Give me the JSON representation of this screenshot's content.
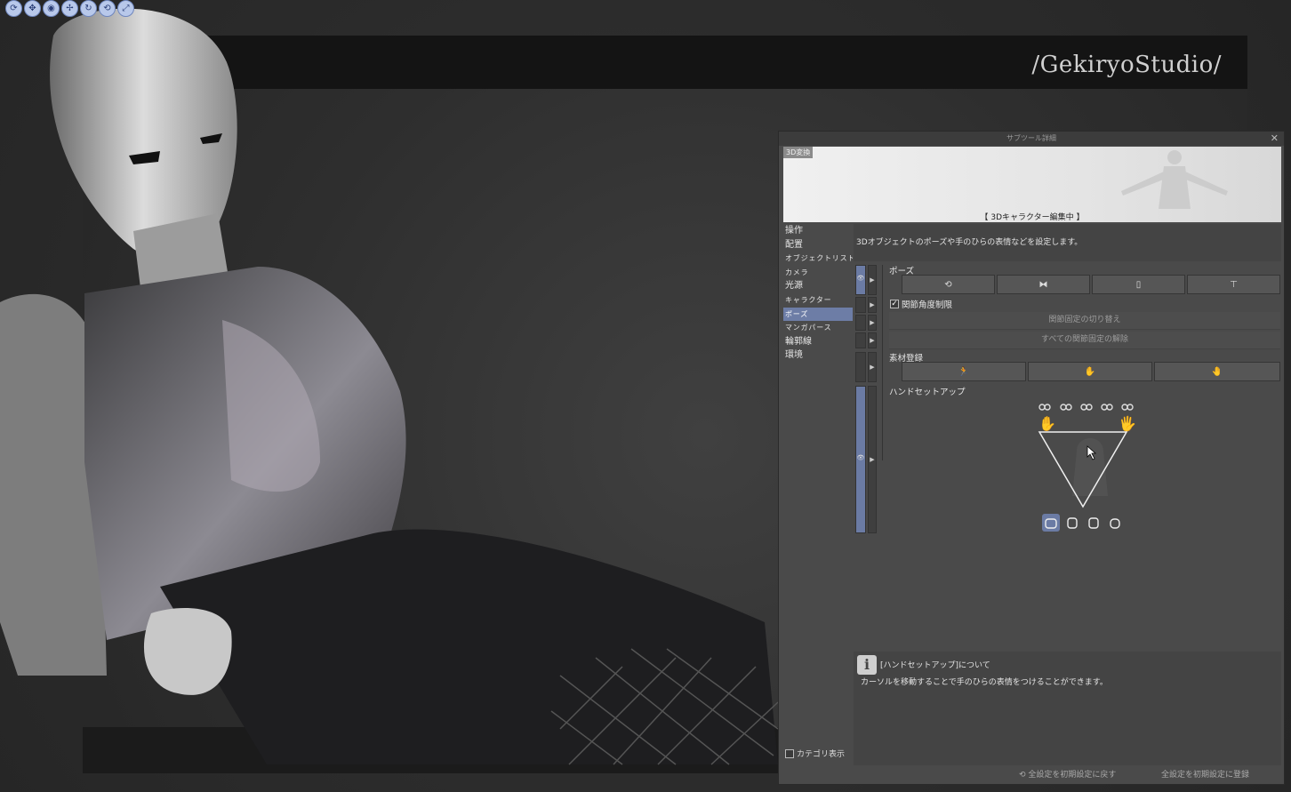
{
  "watermark": "/GekiryoStudio/",
  "toolbar3d": {
    "buttons": [
      "camera-rotate-icon",
      "camera-pan-icon",
      "camera-zoom-icon",
      "object-move-icon",
      "object-rotate-xy-icon",
      "object-rotate-z-icon",
      "object-scale-icon"
    ]
  },
  "panel": {
    "title": "サブツール詳細",
    "close": "✕",
    "preview_tag": "3D変換",
    "preview_caption": "【 3Dキャラクター編集中 】",
    "categories": [
      {
        "label": "操作",
        "small": false
      },
      {
        "label": "配置",
        "small": false
      },
      {
        "label": "オブジェクトリスト",
        "small": true
      },
      {
        "label": "カメラ",
        "small": true
      },
      {
        "label": "光源",
        "small": false
      },
      {
        "label": "キャラクター",
        "small": true
      },
      {
        "label": "ポーズ",
        "small": true,
        "active": true
      },
      {
        "label": "マンガパース",
        "small": true
      },
      {
        "label": "輪郭線",
        "small": false
      },
      {
        "label": "環境",
        "small": false
      }
    ],
    "description": "3Dオブジェクトのポーズや手のひらの表情などを設定します。",
    "pose": {
      "label": "ポーズ",
      "buttons": [
        "reset-pose-icon",
        "flip-horizontal-icon",
        "clipboard-icon",
        "t-pose-icon"
      ],
      "joint_limit_label": "関節角度制限",
      "joint_limit_checked": true,
      "toggle_fix_label": "関節固定の切り替え",
      "release_all_label": "すべての関節固定の解除"
    },
    "material": {
      "label": "素材登録",
      "buttons": [
        "register-pose-icon",
        "register-right-hand-icon",
        "register-left-hand-icon"
      ]
    },
    "hand_setup": {
      "label": "ハンドセットアップ"
    },
    "info": {
      "title": "[ハンドセットアップ]について",
      "text": "カーソルを移動することで手のひらの表情をつけることができます。"
    },
    "footer": {
      "category_toggle": "カテゴリ表示",
      "reset_all": "全設定を初期設定に戻す",
      "register_all": "全設定を初期設定に登録"
    }
  }
}
